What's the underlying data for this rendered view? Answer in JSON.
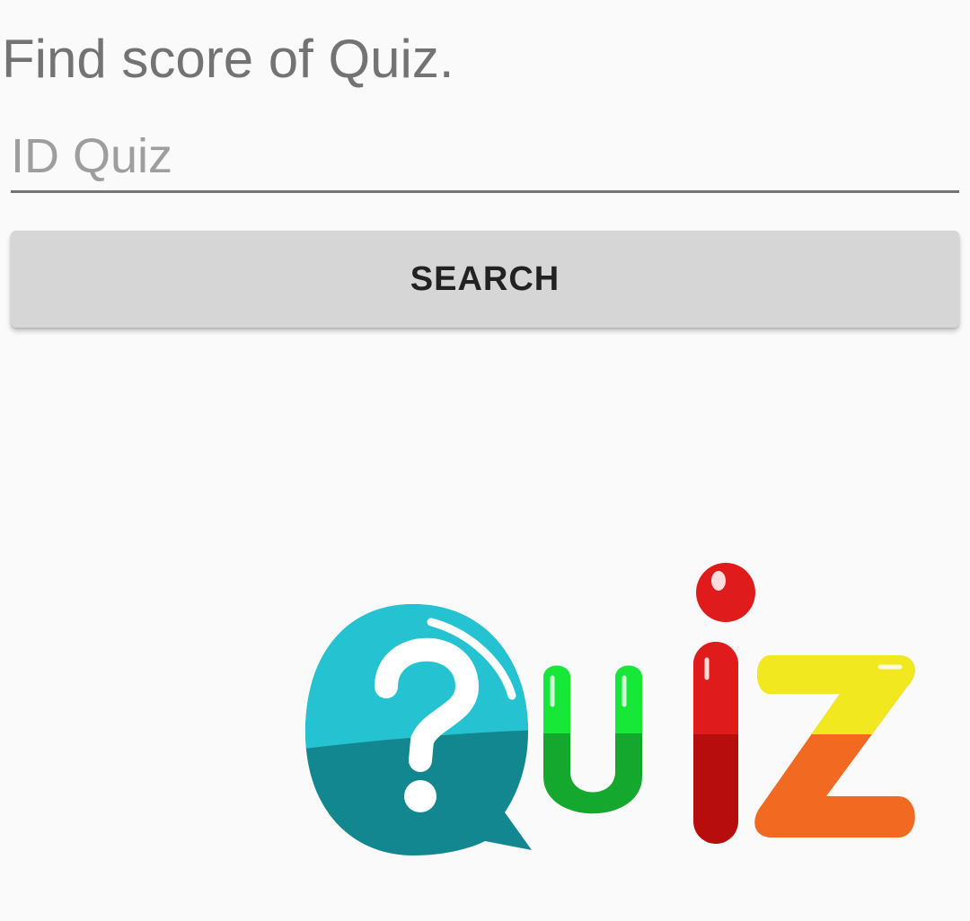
{
  "page": {
    "title": "Find score of Quiz."
  },
  "search": {
    "placeholder": "ID Quiz",
    "value": "",
    "button_label": "SEARCH"
  },
  "logo": {
    "text": "Quiz",
    "colors": {
      "bubble_top": "#25c3d1",
      "bubble_bottom": "#12878f",
      "u_top": "#17e838",
      "u_bottom": "#15a82e",
      "i": "#e01b1b",
      "i_bottom": "#b80d0d",
      "z_top": "#f2e81f",
      "z_bottom": "#f26a22"
    }
  },
  "theme": {
    "background": "#fafafa",
    "title_color": "#737373",
    "button_bg": "#d6d6d6"
  }
}
